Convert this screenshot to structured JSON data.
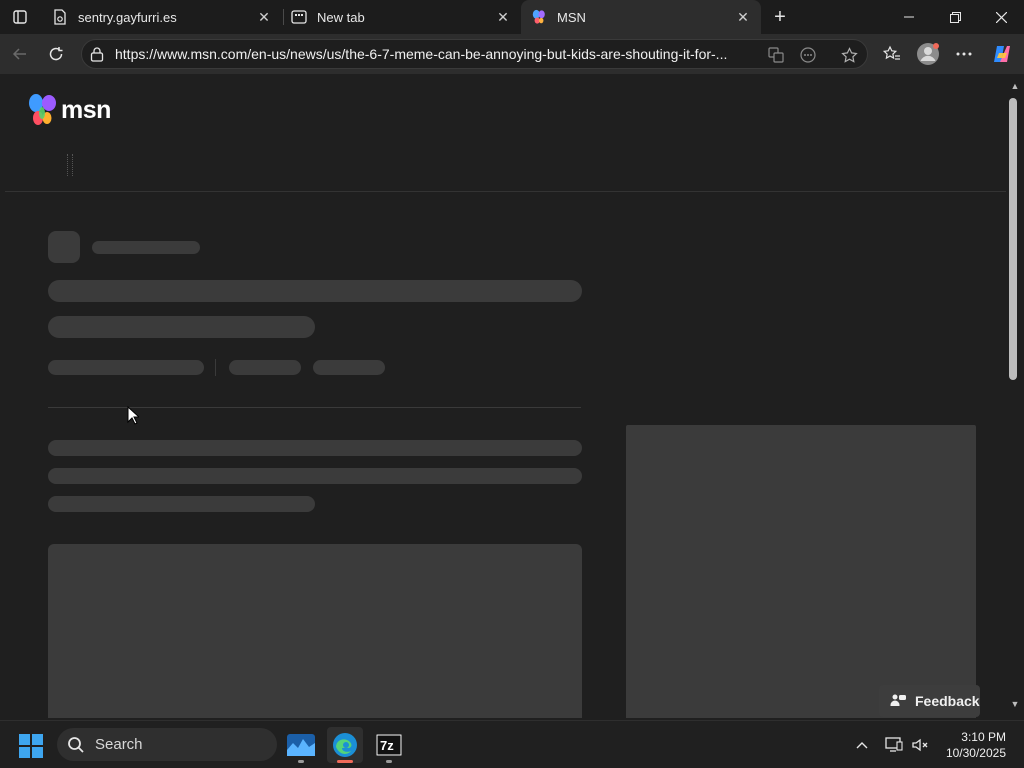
{
  "browser": {
    "tabs": [
      {
        "label": "sentry.gayfurri.es",
        "favicon": "document-icon",
        "active": false
      },
      {
        "label": "New tab",
        "favicon": "newtab-icon",
        "active": false
      },
      {
        "label": "MSN",
        "favicon": "msn-butterfly-icon",
        "active": true
      }
    ],
    "url": "https://www.msn.com/en-us/news/us/the-6-7-meme-can-be-annoying-but-kids-are-shouting-it-for-..."
  },
  "page": {
    "logo_text": "msn",
    "feedback_label": "Feedback"
  },
  "taskbar": {
    "search_label": "Search",
    "apps": [
      "weather-widget-icon",
      "edge-browser-icon",
      "7zip-icon"
    ],
    "time": "3:10 PM",
    "date": "10/30/2025"
  },
  "colors": {
    "skeleton": "#3b3b3b",
    "page_bg": "#1f1f1f",
    "accent": "#f06a5a"
  }
}
